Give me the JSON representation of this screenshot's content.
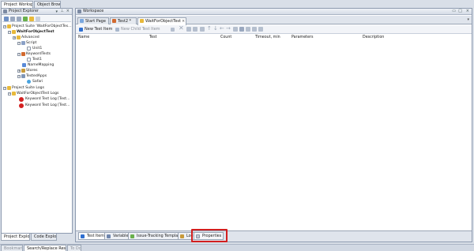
{
  "top_tabs": [
    "Project Workspace",
    "Object Browser"
  ],
  "explorer": {
    "title": "Project Explorer",
    "items": [
      {
        "label": "Project Suite 'WaitForObjectTes..."
      },
      {
        "label": "WaitForObjectTest"
      },
      {
        "label": "Advanced"
      },
      {
        "label": "Script"
      },
      {
        "label": "Unit1"
      },
      {
        "label": "KeywordTests"
      },
      {
        "label": "Test1"
      },
      {
        "label": "NameMapping"
      },
      {
        "label": "Stores"
      },
      {
        "label": "TestedApps"
      },
      {
        "label": "Safari"
      },
      {
        "label": "Project Suite Logs"
      },
      {
        "label": "WaitForObjectTest Logs"
      },
      {
        "label": "Keyword Test Log [Test..."
      },
      {
        "label": "Keyword Test Log [Test..."
      }
    ],
    "bottom_tabs": [
      "Project Explorer",
      "Code Explorer"
    ]
  },
  "workspace": {
    "title": "Workspace",
    "doc_tabs": [
      "Start Page",
      "Test2 *",
      "WaitForObjectTest"
    ],
    "toolbar": {
      "new_test_item": "New Test Item",
      "new_child_test_item": "New Child Test Item"
    },
    "columns": [
      "Name",
      "Test",
      "Count",
      "Timeout, min",
      "Parameters",
      "Description"
    ],
    "bottom_tabs": [
      "Test Items",
      "Variables",
      "Issue-Tracking Templates",
      "Log",
      "Properties"
    ]
  },
  "status_tabs": [
    "Bookmarks",
    "Search/Replace Results",
    "To Do"
  ],
  "colors": {
    "highlight": "#d21f1f",
    "error": "#d32020",
    "folder": "#e8b93a",
    "accent": "#2f6fd0"
  }
}
